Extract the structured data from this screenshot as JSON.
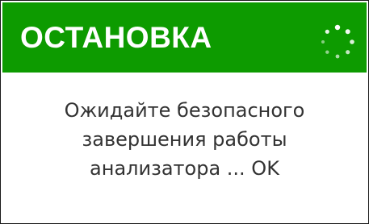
{
  "dialog": {
    "title": "ОСТАНОВКА",
    "header_color": "#0d9b00",
    "spinner_icon": "loading-spinner-icon",
    "message_lines": [
      "Ожидайте безопасного",
      "завершения работы",
      "анализатора ... OK"
    ]
  }
}
